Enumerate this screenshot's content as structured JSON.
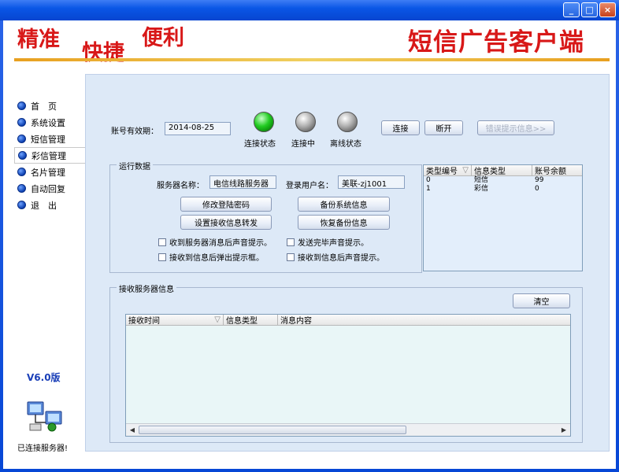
{
  "window": {
    "min_glyph": "_",
    "max_glyph": "□",
    "close_glyph": "×"
  },
  "banner": {
    "slogan1": "精准",
    "slogan2": "快捷",
    "slogan3": "便利",
    "app_title": "短信广告客户端"
  },
  "nav": {
    "items": [
      {
        "label": "首　页"
      },
      {
        "label": "系统设置"
      },
      {
        "label": "短信管理"
      },
      {
        "label": "彩信管理"
      },
      {
        "label": "名片管理"
      },
      {
        "label": "自动回复"
      },
      {
        "label": "退　出"
      }
    ],
    "active_index": 3
  },
  "version": "V6.0版",
  "connection_status": "已连接服务器!",
  "account": {
    "expiry_label": "账号有效期：",
    "expiry_value": "2014-08-25"
  },
  "status": {
    "connected": "连接状态",
    "connecting": "连接中",
    "offline": "离线状态"
  },
  "buttons": {
    "connect": "连接",
    "disconnect": "断开",
    "error_hint": "错误提示信息>>",
    "change_password": "修改登陆密码",
    "backup_system": "备份系统信息",
    "set_forward": "设置接收信息转发",
    "restore_backup": "恢复备份信息",
    "clear": "清空"
  },
  "run_data": {
    "title": "运行数据",
    "server_name_label": "服务器名称：",
    "server_name_value": "电信线路服务器",
    "login_user_label": "登录用户名：",
    "login_user_value": "美联-zj1001"
  },
  "checkboxes": {
    "c1": "收到服务器消息后声音提示。",
    "c2": "发送完毕声音提示。",
    "c3": "接收到信息后弹出提示框。",
    "c4": "接收到信息后声音提示。"
  },
  "balance_table": {
    "headers": [
      "类型编号",
      "信息类型",
      "账号余额"
    ],
    "rows": [
      [
        "0",
        "短信",
        "99"
      ],
      [
        "1",
        "彩信",
        "0"
      ]
    ]
  },
  "receive": {
    "title": "接收服务器信息",
    "headers": [
      "接收时间",
      "信息类型",
      "消息内容"
    ]
  },
  "colors": {
    "slogan_red": "#d81818",
    "accent_gold": "#e8a020",
    "panel_bg": "#dde9f7",
    "led_connected": "#22cc22"
  }
}
